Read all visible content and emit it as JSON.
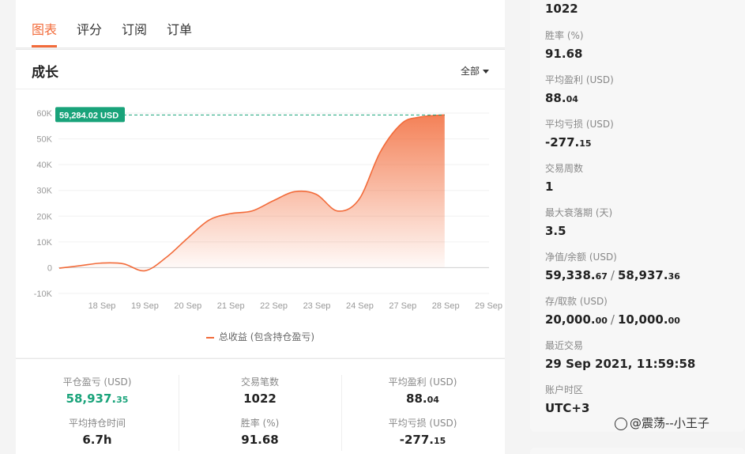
{
  "tabs": [
    {
      "label": "图表",
      "active": true
    },
    {
      "label": "评分",
      "active": false
    },
    {
      "label": "订阅",
      "active": false
    },
    {
      "label": "订单",
      "active": false
    }
  ],
  "chart_section": {
    "title": "成长",
    "filter_label": "全部",
    "legend_label": "总收益 (包含持仓盈亏)"
  },
  "chart_data": {
    "type": "area",
    "title": "",
    "xlabel": "",
    "ylabel": "",
    "ylim": [
      -10000,
      60000
    ],
    "yticks": [
      "60K",
      "50K",
      "40K",
      "30K",
      "20K",
      "10K",
      "0",
      "-10K"
    ],
    "yticks_values": [
      60000,
      50000,
      40000,
      30000,
      20000,
      10000,
      0,
      -10000
    ],
    "xticks": [
      "18 Sep",
      "19 Sep",
      "20 Sep",
      "21 Sep",
      "22 Sep",
      "23 Sep",
      "24 Sep",
      "27 Sep",
      "28 Sep",
      "29 Sep"
    ],
    "current_value_label": "59,284.02 USD",
    "current_value": 59284.02,
    "color": "#f26b3a",
    "series": [
      {
        "name": "总收益 (包含持仓盈亏)",
        "x": [
          0,
          0.5,
          1,
          1.5,
          2,
          2.5,
          3,
          3.5,
          4,
          4.5,
          5,
          5.5,
          6,
          6.5,
          7,
          7.5,
          8,
          8.4,
          8.8,
          9
        ],
        "values": [
          -200,
          800,
          1800,
          1500,
          -1200,
          4000,
          11500,
          18500,
          21000,
          22000,
          26000,
          29500,
          28500,
          22000,
          26500,
          45000,
          56000,
          58400,
          59100,
          59284
        ]
      }
    ]
  },
  "stats": {
    "closed_pnl_label": "平仓盈亏 (USD)",
    "closed_pnl_int": "58,937.",
    "closed_pnl_dec": "35",
    "trades_label": "交易笔数",
    "trades_value": "1022",
    "avg_profit_label": "平均盈利 (USD)",
    "avg_profit_int": "88.",
    "avg_profit_dec": "04",
    "avg_hold_label": "平均持仓时间",
    "avg_hold_value": "6.7h",
    "winrate_label": "胜率 (%)",
    "winrate_value": "91.68",
    "avg_loss_label": "平均亏损 (USD)",
    "avg_loss_int": "-277.",
    "avg_loss_dec": "15"
  },
  "side": {
    "trades_value": "1022",
    "winrate_label": "胜率 (%)",
    "winrate_value": "91.68",
    "avg_profit_label": "平均盈利 (USD)",
    "avg_profit_int": "88.",
    "avg_profit_dec": "04",
    "avg_loss_label": "平均亏损 (USD)",
    "avg_loss_int": "-277.",
    "avg_loss_dec": "15",
    "weeks_label": "交易周数",
    "weeks_value": "1",
    "max_dd_label": "最大衰落期 (天)",
    "max_dd_value": "3.5",
    "equity_label": "净值/余额 (USD)",
    "equity_int": "59,338.",
    "equity_dec": "67",
    "balance_int": "58,937.",
    "balance_dec": "36",
    "deposit_label": "存/取款 (USD)",
    "deposit_int": "20,000.",
    "deposit_dec": "00",
    "withdraw_int": "10,000.",
    "withdraw_dec": "00",
    "last_trade_label": "最近交易",
    "last_trade_value": "29 Sep 2021, 11:59:58",
    "tz_label": "账户时区",
    "tz_value": "UTC+3"
  },
  "watermark": {
    "text": "@震荡--小王子"
  }
}
